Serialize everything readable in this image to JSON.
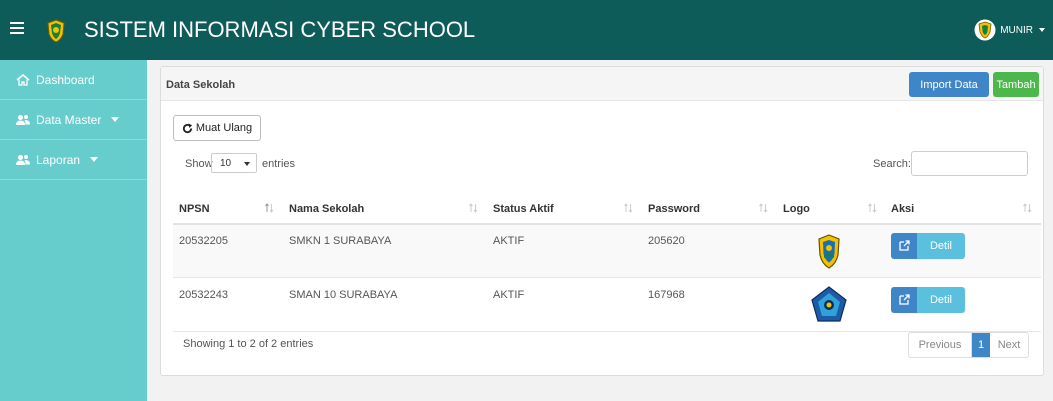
{
  "header": {
    "title": "SISTEM INFORMASI CYBER SCHOOL",
    "user": "MUNIR"
  },
  "sidebar": {
    "items": [
      {
        "label": "Dashboard",
        "icon": "home-icon"
      },
      {
        "label": "Data Master",
        "icon": "users-icon"
      },
      {
        "label": "Laporan",
        "icon": "users-icon"
      }
    ]
  },
  "panel": {
    "title": "Data Sekolah",
    "import_label": "Import Data",
    "add_label": "Tambah",
    "reload_label": "Muat Ulang"
  },
  "table_controls": {
    "show_label": "Show",
    "entries_value": "10",
    "entries_label": "entries",
    "search_label": "Search:",
    "search_value": ""
  },
  "table": {
    "columns": [
      "NPSN",
      "Nama Sekolah",
      "Status Aktif",
      "Password",
      "Logo",
      "Aksi"
    ],
    "rows": [
      {
        "npsn": "20532205",
        "nama": "SMKN 1 SURABAYA",
        "status": "AKTIF",
        "password": "205620",
        "logo": "east-java-crest-logo",
        "aksi": "Detil"
      },
      {
        "npsn": "20532243",
        "nama": "SMAN 10 SURABAYA",
        "status": "AKTIF",
        "password": "167968",
        "logo": "sman10-blue-logo",
        "aksi": "Detil"
      }
    ]
  },
  "footer": {
    "info": "Showing 1 to 2 of 2 entries",
    "prev": "Previous",
    "page": "1",
    "next": "Next"
  },
  "colors": {
    "topbar": "#0e5c5a",
    "sidebar": "#66cccc",
    "primary": "#3f86c8",
    "success": "#4cb84c",
    "info": "#5bc0de"
  }
}
